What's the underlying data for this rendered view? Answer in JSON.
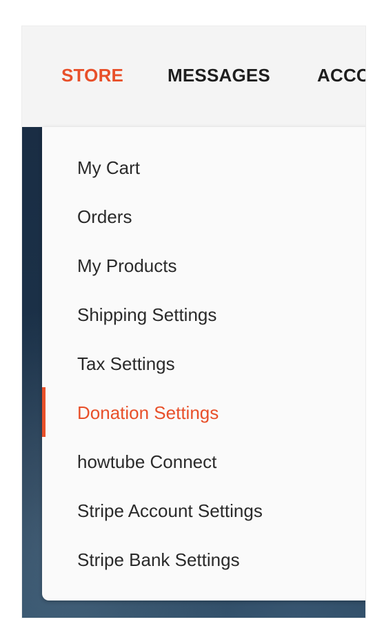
{
  "colors": {
    "accent": "#e8502a",
    "nav_bg": "#f4f4f4",
    "menu_bg": "#fafafa",
    "text": "#2a2a2a"
  },
  "nav": {
    "tabs": [
      {
        "label": "STORE",
        "active": true
      },
      {
        "label": "MESSAGES",
        "active": false
      },
      {
        "label": "ACCC",
        "active": false
      }
    ]
  },
  "store_menu": {
    "active_index": 5,
    "items": [
      {
        "label": "My Cart"
      },
      {
        "label": "Orders"
      },
      {
        "label": "My Products"
      },
      {
        "label": "Shipping Settings"
      },
      {
        "label": "Tax Settings"
      },
      {
        "label": "Donation Settings"
      },
      {
        "label": "howtube Connect"
      },
      {
        "label": "Stripe Account Settings"
      },
      {
        "label": "Stripe Bank Settings"
      }
    ]
  }
}
